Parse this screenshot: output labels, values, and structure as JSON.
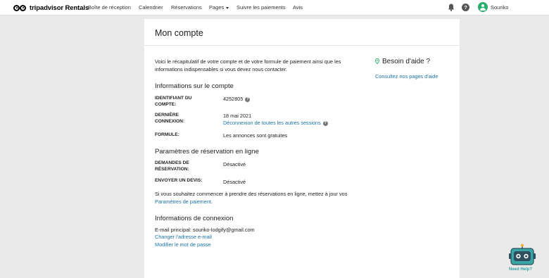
{
  "nav": {
    "logo_brand": "tripadvisor",
    "logo_suffix": " Rentals",
    "links": [
      "Boîte de réception",
      "Calendrier",
      "Réservations",
      "Pages",
      "Suivre les paiements",
      "Avis"
    ],
    "user_name": "Souriko"
  },
  "page": {
    "title": "Mon compte",
    "intro": "Voici le récapitulatif de votre compte et de votre formule de paiement ainsi que les informations indispensables si vous devez nous contacter.",
    "account": {
      "heading": "Informations sur le compte",
      "id_label": "IDENTIFIANT DU COMPTE:",
      "id_value": "4252805",
      "last_login_label": "DERNIÈRE CONNEXION:",
      "last_login_value": "18 mai 2021",
      "logout_all_link": "Déconnexion de toutes les autres sessions",
      "plan_label": "FORMULE:",
      "plan_value": "Les annonces sont gratuites"
    },
    "booking": {
      "heading": "Paramètres de réservation en ligne",
      "requests_label": "DEMANDES DE RÉSERVATION:",
      "requests_value": "Désactivé",
      "quote_label": "ENVOYER UN DEVIS:",
      "quote_value": "Désactivé",
      "note_text": "Si vous souhaitez commencer à prendre des réservations en ligne, mettez à jour vos",
      "payment_link": "Paramètres de paiement",
      "note_end": "."
    },
    "login": {
      "heading": "Informations de connexion",
      "email_line": "E-mail principal: souriko-lodgify@gmail.com",
      "change_email_link": "Changer l'adresse e-mail",
      "change_password_link": "Modifier le mot de passe"
    },
    "help": {
      "title": "Besoin d'aide ?",
      "link": "Consultez nos pages d'aide"
    }
  },
  "widget": {
    "label": "Need Help?"
  },
  "colors": {
    "link": "#1a73a8",
    "avatar": "#2aae6b",
    "background": "#eaeaea",
    "robot": "#3aa5a5"
  },
  "icons": [
    "owl-logo-icon",
    "bell-icon",
    "help-icon",
    "avatar-icon",
    "question-icon",
    "location-pin-icon",
    "robot-icon"
  ]
}
